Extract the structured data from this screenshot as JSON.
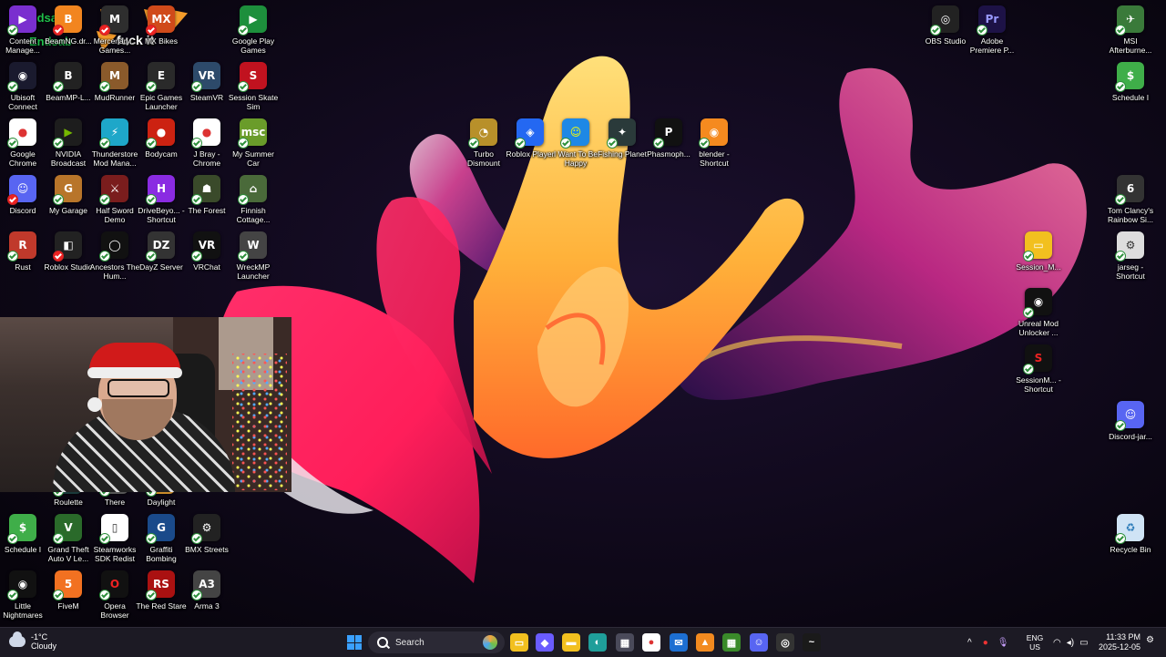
{
  "desktop": {
    "overlay": {
      "brand_top": "Endsab",
      "brand_bottom": "Endsab",
      "meme_text": "fuck it"
    },
    "icons": [
      {
        "label": "Content Manage...",
        "color": "#7a2fcf",
        "glyph": "▶"
      },
      {
        "label": "BeamNG.dr...",
        "color": "#f2851f",
        "glyph": "B"
      },
      {
        "label": "Mercenary... Games...",
        "color": "#2e2e2e",
        "glyph": "M"
      },
      {
        "label": "MX Bikes",
        "color": "#d04a1a",
        "glyph": "MX"
      },
      {
        "label": "Google Play Games",
        "color": "#1d8f3c",
        "glyph": "▶"
      },
      {
        "label": "Ubisoft Connect",
        "color": "#1a1a2e",
        "glyph": "◉"
      },
      {
        "label": "BeamMP-L...",
        "color": "#222",
        "glyph": "B"
      },
      {
        "label": "MudRunner",
        "color": "#8a5a2b",
        "glyph": "M"
      },
      {
        "label": "Epic Games Launcher",
        "color": "#2a2a2a",
        "glyph": "E"
      },
      {
        "label": "SteamVR",
        "color": "#2d4a6a",
        "glyph": "VR"
      },
      {
        "label": "Session Skate Sim",
        "color": "#c1121f",
        "glyph": "S"
      },
      {
        "label": "Google Chrome",
        "color": "#ffffff",
        "glyph": "●",
        "fg": "#d33"
      },
      {
        "label": "NVIDIA Broadcast",
        "color": "#1d1d1d",
        "glyph": "▶",
        "fg": "#76b900"
      },
      {
        "label": "Thunderstore Mod Mana...",
        "color": "#1ea7c9",
        "glyph": "⚡"
      },
      {
        "label": "Bodycam",
        "color": "#c21",
        "glyph": "●"
      },
      {
        "label": "J Bray - Chrome",
        "color": "#ffffff",
        "glyph": "●",
        "fg": "#d33"
      },
      {
        "label": "My Summer Car",
        "color": "#6a9c2a",
        "glyph": "msc"
      },
      {
        "label": "Discord",
        "color": "#5865f2",
        "glyph": "☺"
      },
      {
        "label": "My Garage",
        "color": "#b8752a",
        "glyph": "G"
      },
      {
        "label": "Half Sword Demo",
        "color": "#7a1d1d",
        "glyph": "⚔"
      },
      {
        "label": "DriveBeyo... - Shortcut",
        "color": "#8a2be2",
        "glyph": "H"
      },
      {
        "label": "The Forest",
        "color": "#3a4a2a",
        "glyph": "☗"
      },
      {
        "label": "Finnish Cottage...",
        "color": "#4a6a3a",
        "glyph": "⌂"
      },
      {
        "label": "Rust",
        "color": "#c0392b",
        "glyph": "R"
      },
      {
        "label": "Roblox Studio",
        "color": "#222",
        "glyph": "◧"
      },
      {
        "label": "Ancestors The Hum...",
        "color": "#111",
        "glyph": "◯"
      },
      {
        "label": "DayZ Server",
        "color": "#333",
        "glyph": "DZ"
      },
      {
        "label": "VRChat",
        "color": "#111",
        "glyph": "VR"
      },
      {
        "label": "WreckMP Launcher",
        "color": "#444",
        "glyph": "W"
      },
      {
        "label": "Roulette",
        "color": "#1a3a3a",
        "glyph": "~"
      },
      {
        "label": "There",
        "color": "#555",
        "glyph": "☗"
      },
      {
        "label": "Daylight",
        "color": "#c88a2a",
        "glyph": "☀"
      },
      {
        "label": "Schedule I",
        "color": "#3fae49",
        "glyph": "$"
      },
      {
        "label": "Grand Theft Auto V Le...",
        "color": "#2a6a2a",
        "glyph": "V"
      },
      {
        "label": "Steamworks SDK Redist",
        "color": "#fff",
        "glyph": "▯",
        "fg": "#333"
      },
      {
        "label": "Graffiti Bombing",
        "color": "#1a4a8a",
        "glyph": "G"
      },
      {
        "label": "BMX Streets",
        "color": "#222",
        "glyph": "⚙"
      },
      {
        "label": "Little Nightmares",
        "color": "#111",
        "glyph": "◉"
      },
      {
        "label": "FiveM",
        "color": "#f27121",
        "glyph": "5"
      },
      {
        "label": "Opera Browser",
        "color": "#111",
        "glyph": "O",
        "fg": "#e22"
      },
      {
        "label": "The Red Stare",
        "color": "#a11",
        "glyph": "RS"
      },
      {
        "label": "Arma 3",
        "color": "#444",
        "glyph": "A3"
      },
      {
        "label": "Turbo Dismount",
        "color": "#b8902a",
        "glyph": "◔"
      },
      {
        "label": "Roblox Player",
        "color": "#2468f2",
        "glyph": "◈"
      },
      {
        "label": "I Want To Be Happy",
        "color": "#1e88e5",
        "glyph": "☺",
        "fg": "#ff0"
      },
      {
        "label": "Fishing Planet",
        "color": "#2a3a3a",
        "glyph": "✦"
      },
      {
        "label": "Phasmoph...",
        "color": "#111",
        "glyph": "P"
      },
      {
        "label": "blender - Shortcut",
        "color": "#f58a1f",
        "glyph": "◉"
      },
      {
        "label": "OBS Studio",
        "color": "#222",
        "glyph": "◎"
      },
      {
        "label": "Adobe Premiere P...",
        "color": "#1d1246",
        "glyph": "Pr",
        "fg": "#9999ff"
      },
      {
        "label": "MSI Afterburne...",
        "color": "#3a7a3a",
        "glyph": "✈"
      },
      {
        "label": "Schedule I",
        "color": "#3fae49",
        "glyph": "$"
      },
      {
        "label": "Tom Clancy's Rainbow Si...",
        "color": "#333",
        "glyph": "6"
      },
      {
        "label": "Session_M...",
        "color": "#f2c01f",
        "glyph": "▭"
      },
      {
        "label": "jarseg - Shortcut",
        "color": "#ddd",
        "glyph": "⚙",
        "fg": "#333"
      },
      {
        "label": "Unreal Mod Unlocker ...",
        "color": "#111",
        "glyph": "◉"
      },
      {
        "label": "SessionM... - Shortcut",
        "color": "#111",
        "glyph": "S",
        "fg": "#e22"
      },
      {
        "label": "Discord-jar...",
        "color": "#5865f2",
        "glyph": "☺"
      },
      {
        "label": "Recycle Bin",
        "color": "#cfe3f5",
        "glyph": "♻",
        "fg": "#2a7ab8"
      }
    ]
  },
  "taskbar": {
    "weather": {
      "temp": "-1°C",
      "condition": "Cloudy"
    },
    "search_placeholder": "Search",
    "apps": [
      {
        "name": "file-explorer",
        "color": "#f2c01f",
        "glyph": "▭"
      },
      {
        "name": "copilot",
        "color": "#6a5cff",
        "glyph": "◆"
      },
      {
        "name": "folder",
        "color": "#f2c01f",
        "glyph": "▬"
      },
      {
        "name": "edge",
        "color": "#1f9e9a",
        "glyph": "◐"
      },
      {
        "name": "store",
        "color": "#4a4a5a",
        "glyph": "▦"
      },
      {
        "name": "chrome",
        "color": "#ffffff",
        "glyph": "●"
      },
      {
        "name": "mail",
        "color": "#1d6fd2",
        "glyph": "✉"
      },
      {
        "name": "vlc",
        "color": "#f28a1f",
        "glyph": "▲"
      },
      {
        "name": "minecraft",
        "color": "#3a8a2a",
        "glyph": "▦"
      },
      {
        "name": "discord",
        "color": "#5865f2",
        "glyph": "☺"
      },
      {
        "name": "obs",
        "color": "#333",
        "glyph": "◎"
      },
      {
        "name": "terminal",
        "color": "#1a1a1a",
        "glyph": "~"
      }
    ],
    "language": {
      "top": "ENG",
      "bottom": "US"
    },
    "clock": {
      "time": "11:33 PM",
      "date": "2025-12-05"
    }
  }
}
